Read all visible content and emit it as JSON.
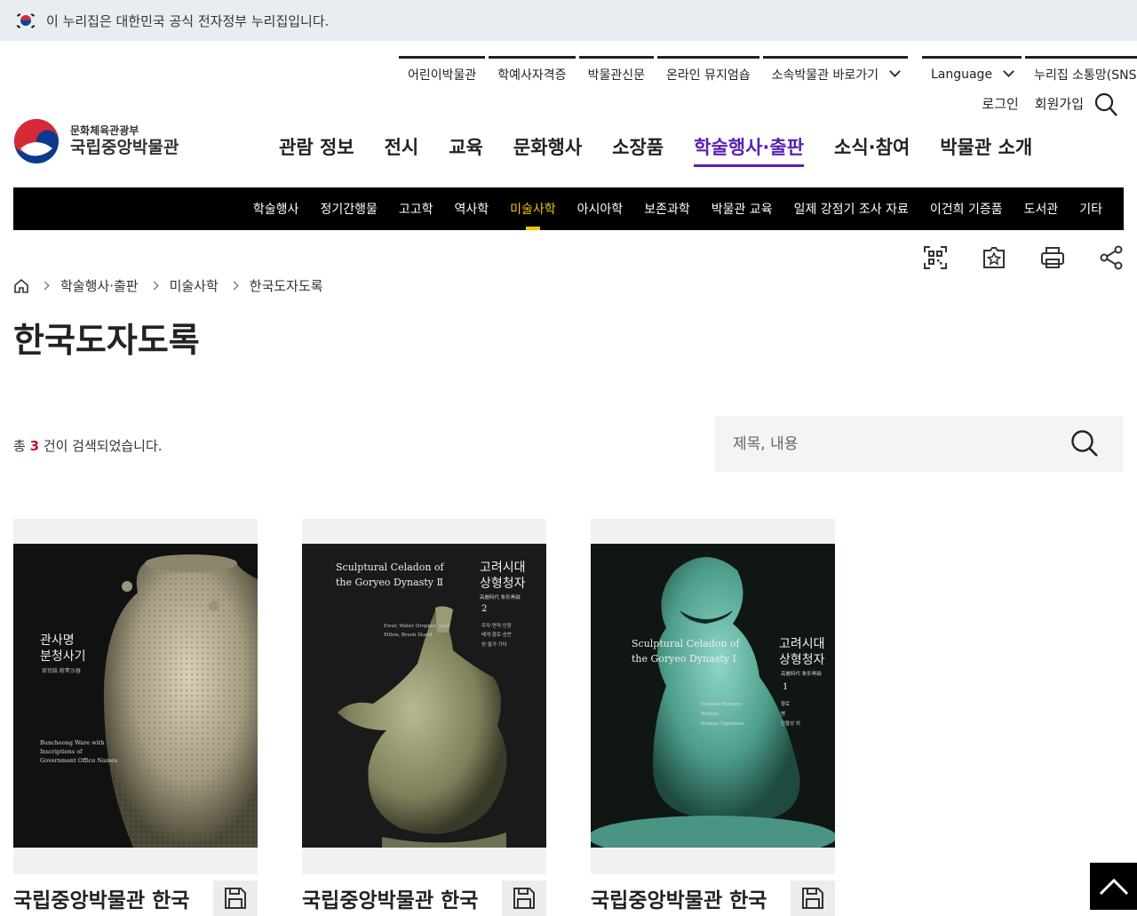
{
  "gov_banner": {
    "text": "이 누리집은 대한민국 공식 전자정부 누리집입니다."
  },
  "utility": {
    "items": [
      "어린이박물관",
      "학예사자격증",
      "박물관신문",
      "온라인 뮤지엄숍"
    ],
    "dropdown1": "소속박물관 바로가기",
    "dropdown2": "Language",
    "sns": "누리집 소통망(SNS)",
    "login": "로그인",
    "signup": "회원가입"
  },
  "logo": {
    "ministry": "문화체육관광부",
    "name": "국립중앙박물관"
  },
  "gnb": [
    "관람 정보",
    "전시",
    "교육",
    "문화행사",
    "소장품",
    "학술행사·출판",
    "소식·참여",
    "박물관 소개"
  ],
  "gnb_active": "학술행사·출판",
  "subnav": [
    "학술행사",
    "정기간행물",
    "고고학",
    "역사학",
    "미술사학",
    "아시아학",
    "보존과학",
    "박물관 교육",
    "일제 강점기 조사 자료",
    "이건희 기증품",
    "도서관",
    "기타"
  ],
  "subnav_active": "미술사학",
  "breadcrumb": [
    "학술행사·출판",
    "미술사학",
    "한국도자도록"
  ],
  "page_title": "한국도자도록",
  "result": {
    "prefix": "총",
    "count": "3",
    "suffix": "건이 검색되었습니다."
  },
  "search": {
    "placeholder": "제목, 내용"
  },
  "cards": [
    {
      "title": "국립중앙박물관 한국",
      "cover_ko": "관사명\n분청사기",
      "cover_hanja": "官司銘 粉靑沙器",
      "cover_en": "Buncheong Ware with\nInscriptions of\nGovernment Office Names",
      "bg": "#111111"
    },
    {
      "title": "국립중앙박물관 한국",
      "cover_en": "Sculptural Celadon of\nthe Goryeo Dynasty Ⅱ",
      "cover_ko": "고려시대\n상형청자",
      "cover_hanja": "高麗時代 象形靑磁",
      "cover_num": "2",
      "cover_sub_en": "Ewer, Water Dropper, Seal\nPillow, Brush Stand",
      "cover_sub_ko": "주자·연적·인장\n베개·향로·승반\n완·필가·기타",
      "bg": "#1a1a1a"
    },
    {
      "title": "국립중앙박물관 한국",
      "cover_en": "Sculptural Celadon of\nthe Goryeo Dynasty Ⅰ",
      "cover_ko": "고려시대\n상형청자",
      "cover_hanja": "高麗時代 象形靑磁",
      "cover_num": "1",
      "cover_sub_en": "Incense Burners\nBottles\nHuman Figurines",
      "cover_sub_ko": "향로\n병\n인물상 외",
      "bg": "#101614"
    }
  ]
}
